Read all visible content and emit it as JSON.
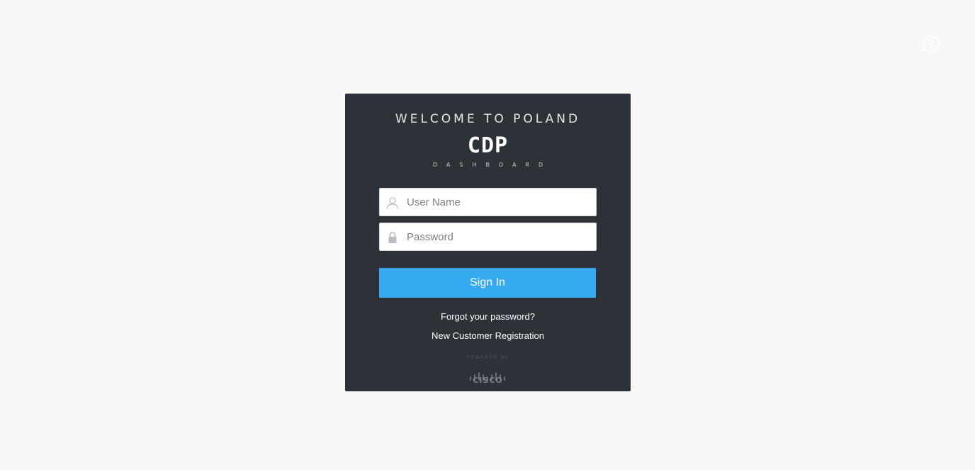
{
  "header": {
    "help_icon": "help-circle-icon"
  },
  "login": {
    "welcome_text": "WELCOME TO POLAND",
    "logo_text": "CDP",
    "logo_subtitle": "DASHBOARD",
    "username": {
      "placeholder": "User Name",
      "value": "",
      "icon": "user-icon"
    },
    "password": {
      "placeholder": "Password",
      "value": "",
      "icon": "lock-icon"
    },
    "signin_label": "Sign In",
    "forgot_password_label": "Forgot your password?",
    "register_label": "New Customer Registration",
    "powered_by_label": "POWERED BY",
    "vendor_name": "CISCO"
  },
  "colors": {
    "page_background": "#f8f8f8",
    "card_background": "#2c3238",
    "accent": "#35aaf0",
    "text_light": "#ffffff"
  }
}
